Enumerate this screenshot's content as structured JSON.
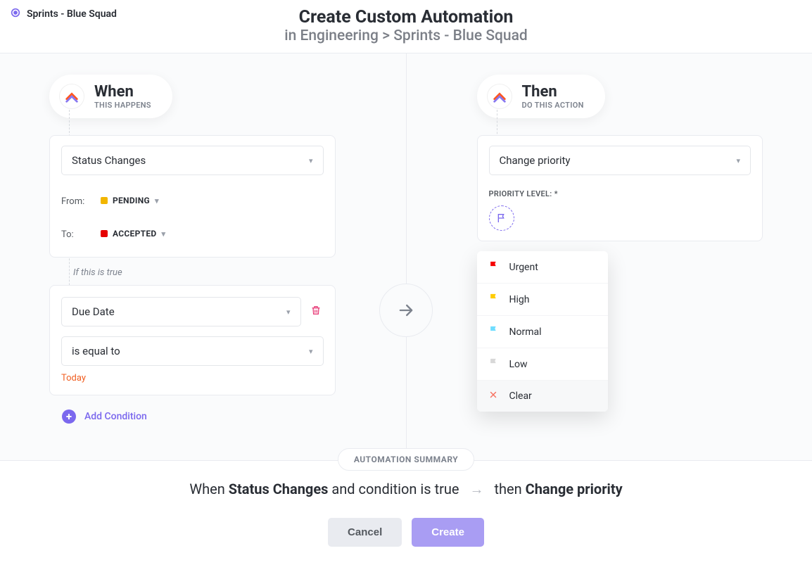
{
  "breadcrumb": "Sprints - Blue Squad",
  "title": "Create Custom Automation",
  "subtitle": "in Engineering > Sprints - Blue Squad",
  "when": {
    "title": "When",
    "subtitle": "THIS HAPPENS",
    "trigger": "Status Changes",
    "from_label": "From:",
    "from_status": "PENDING",
    "from_color": "#f2b600",
    "to_label": "To:",
    "to_status": "ACCEPTED",
    "to_color": "#e50000"
  },
  "condition": {
    "header": "If this is true",
    "field": "Due Date",
    "operator": "is equal to",
    "value": "Today",
    "add_label": "Add Condition"
  },
  "then": {
    "title": "Then",
    "subtitle": "DO THIS ACTION",
    "action": "Change priority",
    "priority_label": "PRIORITY LEVEL: *"
  },
  "priority_options": [
    {
      "label": "Urgent",
      "color": "#f50000"
    },
    {
      "label": "High",
      "color": "#ffcc00"
    },
    {
      "label": "Normal",
      "color": "#6fddff"
    },
    {
      "label": "Low",
      "color": "#d8d8d8"
    },
    {
      "label": "Clear",
      "color": "#f77261",
      "is_clear": true
    }
  ],
  "summary": {
    "badge": "AUTOMATION SUMMARY",
    "when_prefix": "When ",
    "trigger": "Status Changes",
    "cond": " and condition is true",
    "then_prefix": "then ",
    "action": "Change priority"
  },
  "buttons": {
    "cancel": "Cancel",
    "create": "Create"
  }
}
